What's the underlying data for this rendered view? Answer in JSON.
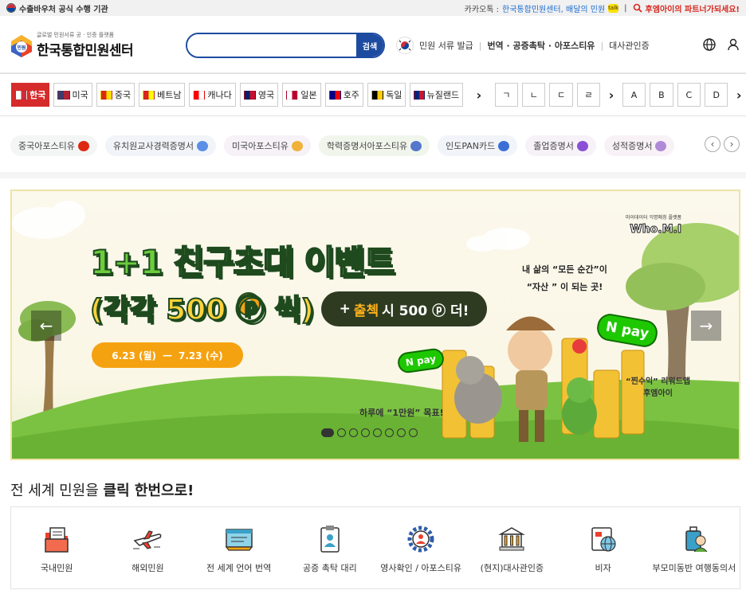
{
  "topbar": {
    "badge": "수출바우처 공식 수행 기관",
    "kakao_label": "카카오톡 :",
    "kakao_link": "한국통합민원센터, 배달의 민원",
    "kakao_icon": "talk",
    "divider": "|",
    "partner": "후엠아이의 파트너가되세요!"
  },
  "header": {
    "logo_sub": "글로벌 민원서류 공 · 인증 플랫폼",
    "logo_main": "한국통합민원센터",
    "logo_badge": "민원",
    "search_placeholder": "",
    "search_button": "검색",
    "nav": {
      "issue": "민원 서류 발급",
      "translation": "번역 · 공증촉탁 · 아포스티유",
      "embassy": "대사관인증"
    }
  },
  "countries": {
    "tabs": [
      {
        "label": "한국",
        "flag_colors": [
          "#ffffff",
          "#cd2e3a"
        ],
        "active": true
      },
      {
        "label": "미국",
        "flag_colors": [
          "#3c3b6e",
          "#b22234"
        ],
        "active": false
      },
      {
        "label": "중국",
        "flag_colors": [
          "#de2910",
          "#ffde00"
        ],
        "active": false
      },
      {
        "label": "베트남",
        "flag_colors": [
          "#da251d",
          "#ffff00"
        ],
        "active": false
      },
      {
        "label": "캐나다",
        "flag_colors": [
          "#ff0000",
          "#ffffff"
        ],
        "active": false
      },
      {
        "label": "영국",
        "flag_colors": [
          "#012169",
          "#c8102e"
        ],
        "active": false
      },
      {
        "label": "일본",
        "flag_colors": [
          "#ffffff",
          "#bc002d"
        ],
        "active": false
      },
      {
        "label": "호주",
        "flag_colors": [
          "#00008b",
          "#ff0000"
        ],
        "active": false
      },
      {
        "label": "독일",
        "flag_colors": [
          "#000000",
          "#ffce00"
        ],
        "active": false
      },
      {
        "label": "뉴질랜드",
        "flag_colors": [
          "#00247d",
          "#cc142b"
        ],
        "active": false
      }
    ],
    "next_arrow": "›",
    "hangul": [
      "ㄱ",
      "ㄴ",
      "ㄷ",
      "ㄹ"
    ],
    "latin": [
      "A",
      "B",
      "C",
      "D"
    ]
  },
  "chips": [
    {
      "label": "중국아포스티유",
      "bg": "#f3f6f5",
      "icon": "china-flag-icon",
      "icon_color": "#de2910"
    },
    {
      "label": "유치원교사경력증명서",
      "bg": "#f1f4f8",
      "icon": "id-card-icon",
      "icon_color": "#5b8ee6"
    },
    {
      "label": "미국아포스티유",
      "bg": "#f6f2f8",
      "icon": "medal-icon",
      "icon_color": "#f0b23a"
    },
    {
      "label": "학력증명서아포스티유",
      "bg": "#f0f6ec",
      "icon": "graduation-icon",
      "icon_color": "#5577cc"
    },
    {
      "label": "인도PAN카드",
      "bg": "#f1f4f8",
      "icon": "card-icon",
      "icon_color": "#3c6fd6"
    },
    {
      "label": "졸업증명서",
      "bg": "#f6f2f8",
      "icon": "cap-icon",
      "icon_color": "#8a4fd6"
    },
    {
      "label": "성적증명서",
      "bg": "#f8f2f6",
      "icon": "document-icon",
      "icon_color": "#b08ad8"
    }
  ],
  "chip_nav": {
    "prev": "‹",
    "next": "›"
  },
  "banner": {
    "title_green": "1+1 친구초대",
    "title_white": "이벤트",
    "subtitle": "(각각 500 ⓟ 씩)",
    "pill_plus": "+",
    "pill_orange": "출첵",
    "pill_text": "시 500 ⓟ 더!",
    "date_start": "6.23 (월)",
    "date_dash": "—",
    "date_end": "7.23 (수)",
    "goal": "하루에 “1만원” 목표!",
    "quote_line1": "내 삶의 “모든 순간”이",
    "quote_line2": "“자산 ” 이 되는 곳!",
    "review_line1": "“찐수익” 리워드앱",
    "review_line2": "후엠아이",
    "brand_tiny": "마이데이터 익명매칭 플랫폼",
    "brand": "Who.M.I",
    "npay": "N pay",
    "prev": "←",
    "next": "→",
    "slide_count": 8,
    "active_slide": 0
  },
  "section": {
    "title_normal": "전 세계 민원을 ",
    "title_bold": "클릭 한번으로!"
  },
  "services": [
    {
      "label": "국내민원",
      "icon": "folder-document-icon"
    },
    {
      "label": "해외민원",
      "icon": "airplane-icon"
    },
    {
      "label": "전 세계 언어 번역",
      "icon": "translation-card-icon"
    },
    {
      "label": "공증 촉탁 대리",
      "icon": "notary-badge-icon"
    },
    {
      "label": "영사확인 / 아포스티유",
      "icon": "apostille-gear-icon"
    },
    {
      "label": "(현지)대사관인증",
      "icon": "embassy-building-icon"
    },
    {
      "label": "비자",
      "icon": "visa-icon"
    },
    {
      "label": "부모미동반 여행동의서",
      "icon": "travel-consent-icon"
    }
  ]
}
